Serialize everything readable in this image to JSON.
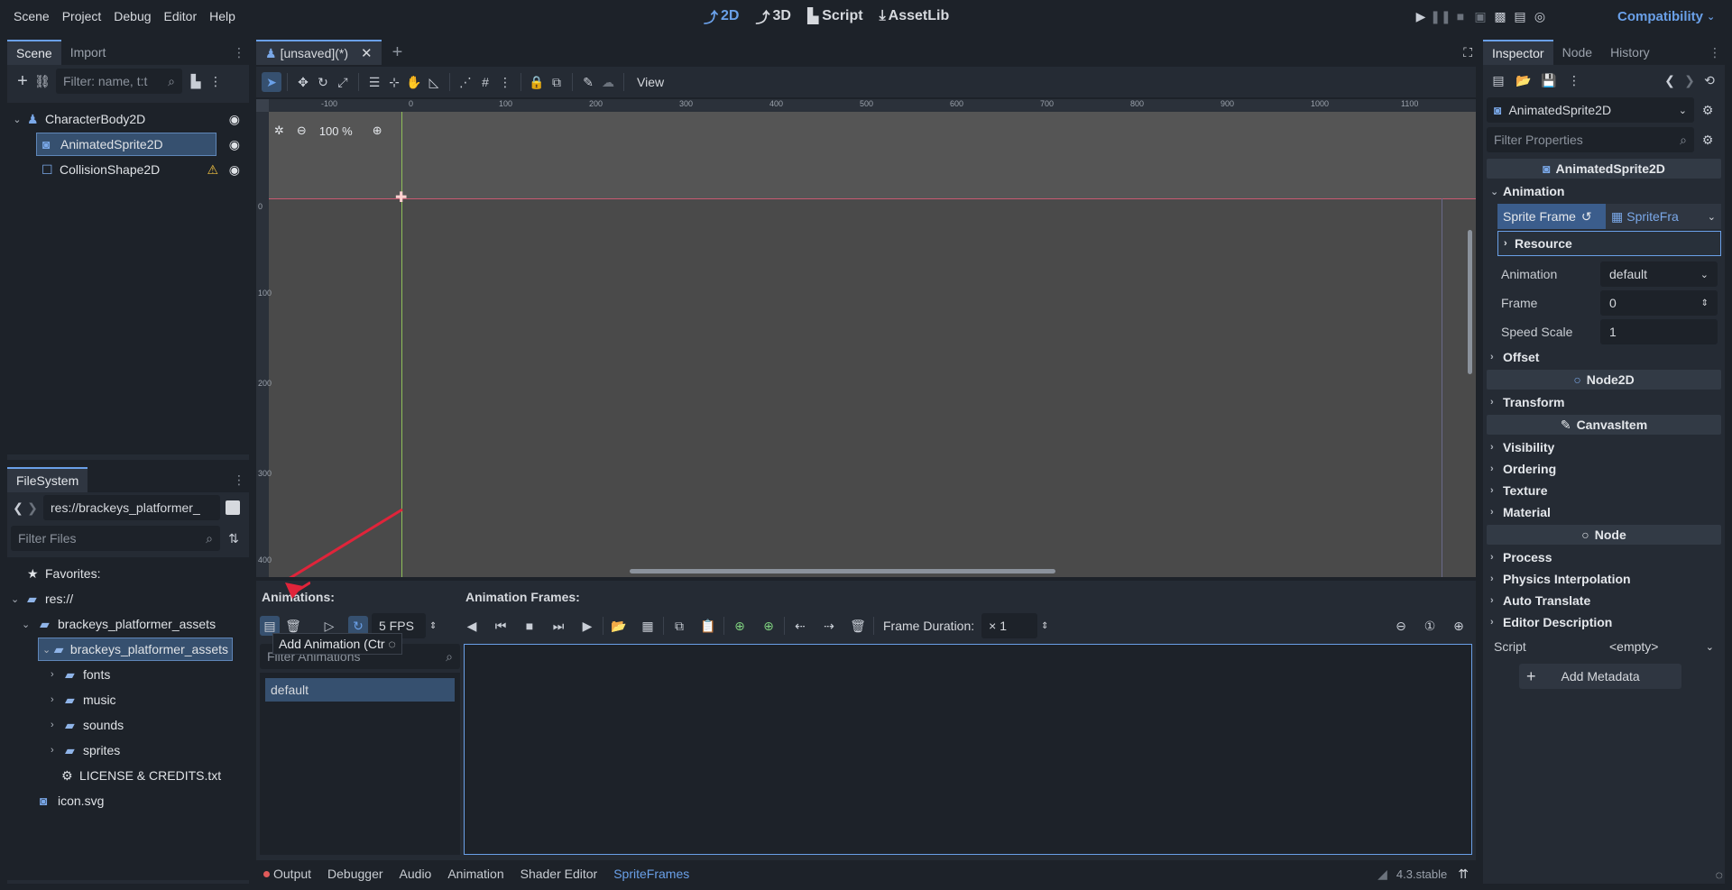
{
  "menu": [
    "Scene",
    "Project",
    "Debug",
    "Editor",
    "Help"
  ],
  "workspaces": [
    {
      "label": "2D",
      "icon": "2d-icon",
      "active": true
    },
    {
      "label": "3D",
      "icon": "3d-icon",
      "active": false
    },
    {
      "label": "Script",
      "icon": "script-icon",
      "active": false
    },
    {
      "label": "AssetLib",
      "icon": "assetlib-icon",
      "active": false
    }
  ],
  "renderer": "Compatibility",
  "scene_dock": {
    "tabs": [
      "Scene",
      "Import"
    ],
    "filter_placeholder": "Filter: name, t:t",
    "nodes": [
      {
        "name": "CharacterBody2D",
        "icon": "character-body-icon",
        "depth": 0
      },
      {
        "name": "AnimatedSprite2D",
        "icon": "animated-sprite-icon",
        "depth": 1,
        "selected": true
      },
      {
        "name": "CollisionShape2D",
        "icon": "collision-shape-icon",
        "depth": 1,
        "warning": true
      }
    ]
  },
  "filesystem": {
    "tab": "FileSystem",
    "path": "res://brackeys_platformer_",
    "filter_placeholder": "Filter Files",
    "items": [
      {
        "name": "Favorites:",
        "icon": "star-icon",
        "depth": 0
      },
      {
        "name": "res://",
        "icon": "folder-icon",
        "depth": 0
      },
      {
        "name": "brackeys_platformer_assets",
        "icon": "folder-icon",
        "depth": 1
      },
      {
        "name": "brackeys_platformer_assets",
        "icon": "folder-icon",
        "depth": 2,
        "selected": true
      },
      {
        "name": "fonts",
        "icon": "folder-icon",
        "depth": 3
      },
      {
        "name": "music",
        "icon": "folder-icon",
        "depth": 3
      },
      {
        "name": "sounds",
        "icon": "folder-icon",
        "depth": 3
      },
      {
        "name": "sprites",
        "icon": "folder-icon",
        "depth": 3
      },
      {
        "name": "LICENSE & CREDITS.txt",
        "icon": "text-file-icon",
        "depth": 3
      },
      {
        "name": "icon.svg",
        "icon": "svg-file-icon",
        "depth": 1
      }
    ]
  },
  "editor_tab": {
    "label": "[unsaved](*)"
  },
  "toolbar": {
    "view_label": "View"
  },
  "viewport": {
    "zoom": "100 %",
    "ruler_x": [
      "-100",
      "0",
      "100",
      "200",
      "300",
      "400",
      "500",
      "600",
      "700",
      "800",
      "900",
      "1000",
      "1100"
    ],
    "ruler_y": [
      "0",
      "100",
      "200",
      "300",
      "400"
    ]
  },
  "spriteframes": {
    "animations_label": "Animations:",
    "frames_label": "Animation Frames:",
    "fps": "5 FPS",
    "frame_duration_label": "Frame Duration:",
    "frame_duration_value": "× 1",
    "filter_placeholder": "Filter Animations",
    "animations": [
      "default"
    ],
    "tooltip": "Add Animation (Ctr"
  },
  "bottom_tabs": [
    "Output",
    "Debugger",
    "Audio",
    "Animation",
    "Shader Editor",
    "SpriteFrames"
  ],
  "version": "4.3.stable",
  "inspector": {
    "tabs": [
      "Inspector",
      "Node",
      "History"
    ],
    "node_name": "AnimatedSprite2D",
    "filter_placeholder": "Filter Properties",
    "class_header": "AnimatedSprite2D",
    "sections": {
      "animation": "Animation",
      "sprite_frames_label": "Sprite Frame",
      "sprite_frames_value": "SpriteFra",
      "resource": "Resource",
      "props": [
        {
          "name": "Animation",
          "value": "default"
        },
        {
          "name": "Frame",
          "value": "0"
        },
        {
          "name": "Speed Scale",
          "value": "1"
        }
      ],
      "offset": "Offset",
      "node2d": "Node2D",
      "transform": "Transform",
      "canvasitem": "CanvasItem",
      "canvas_groups": [
        "Visibility",
        "Ordering",
        "Texture",
        "Material"
      ],
      "node": "Node",
      "node_groups": [
        "Process",
        "Physics Interpolation",
        "Auto Translate",
        "Editor Description"
      ],
      "script_label": "Script",
      "script_value": "<empty>",
      "add_metadata": "Add Metadata"
    }
  }
}
